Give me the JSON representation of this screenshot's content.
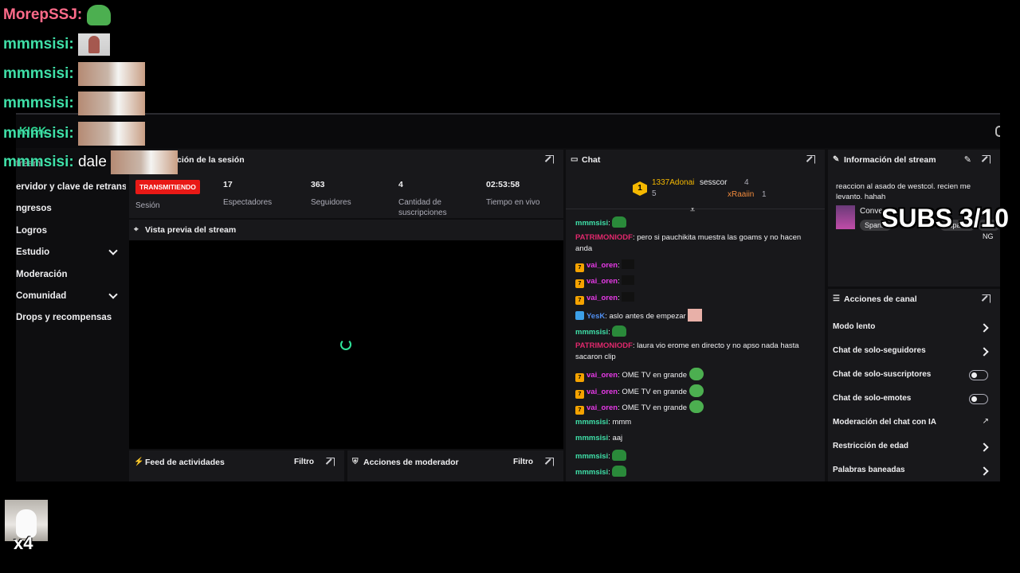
{
  "overlay_chat": [
    {
      "user": "MorepSSJ",
      "colon": ":",
      "text": "",
      "emote": "pepe",
      "color": "#ff6b8a"
    },
    {
      "user": "mmmsisi",
      "colon": ":",
      "text": "",
      "emote": "face",
      "color": "#3fe0a8"
    },
    {
      "user": "mmmsisi",
      "colon": ":",
      "text": "",
      "emote": "cat",
      "color": "#3fe0a8"
    },
    {
      "user": "mmmsisi",
      "colon": ":",
      "text": "",
      "emote": "cat",
      "color": "#3fe0a8"
    },
    {
      "user": "mmmsisi",
      "colon": ":",
      "text": "",
      "emote": "cat",
      "color": "#3fe0a8"
    },
    {
      "user": "mmmsisi",
      "colon": ":",
      "text": "dale",
      "emote": "cat",
      "color": "#3fe0a8"
    }
  ],
  "subs_goal": "SUBS 3/10",
  "cat_alert": {
    "count": "x4"
  },
  "sidebar": {
    "partial_top": "tream",
    "items": [
      {
        "label": "ervidor y clave de retransm",
        "chevron": false
      },
      {
        "label": "ngresos",
        "chevron": false
      },
      {
        "label": "Logros",
        "chevron": false
      },
      {
        "label": "Estudio",
        "chevron": true
      },
      {
        "label": "Moderación",
        "chevron": false
      },
      {
        "label": "Comunidad",
        "chevron": true
      },
      {
        "label": "Drops y recompensas",
        "chevron": false
      }
    ]
  },
  "session": {
    "title": "ción de la sesión",
    "status_badge": "TRANSMITIENDO",
    "status_label": "Sesión",
    "stats": [
      {
        "value": "17",
        "label": "Espectadores"
      },
      {
        "value": "363",
        "label": "Seguidores"
      },
      {
        "value": "4",
        "label": "Cantidad de suscripciones"
      },
      {
        "value": "02:53:58",
        "label": "Tiempo en vivo"
      }
    ]
  },
  "preview": {
    "title": "Vista previa del stream"
  },
  "activity_feed": {
    "title": "Feed de actividades",
    "filter": "Filtro"
  },
  "mod_actions": {
    "title": "Acciones de moderador",
    "filter": "Filtro"
  },
  "chat": {
    "title": "Chat",
    "leaderboard": {
      "rank": "1",
      "first": {
        "name": "1337Adonai",
        "count": "5"
      },
      "second": {
        "name": "sesscor",
        "count": "4"
      },
      "third": {
        "name": "xRaaiin",
        "count": "1"
      }
    },
    "messages": [
      {
        "user": "mmmsisi",
        "color": "#3fe0a8",
        "text": "",
        "emote": "green",
        "badge": ""
      },
      {
        "user": "PATRIMONIODF",
        "color": "#e0286c",
        "text": ": pero si pauchikita muestra las goams y no hacen anda",
        "emote": "",
        "badge": ""
      },
      {
        "user": "vai_oren",
        "color": "#e83ae8",
        "text": ":",
        "emote": "dark",
        "badge": "7"
      },
      {
        "user": "vai_oren",
        "color": "#e83ae8",
        "text": ":",
        "emote": "dark",
        "badge": "7"
      },
      {
        "user": "vai_oren",
        "color": "#e83ae8",
        "text": ":",
        "emote": "dark",
        "badge": "7"
      },
      {
        "user": "YesK",
        "color": "#4f8ef0",
        "text": ": aslo antes de empezar",
        "emote": "pink",
        "badge": "b"
      },
      {
        "user": "mmmsisi",
        "color": "#3fe0a8",
        "text": ":",
        "emote": "green",
        "badge": ""
      },
      {
        "user": "PATRIMONIODF",
        "color": "#e0286c",
        "text": ": laura      vio erome en directo y no apso nada hasta sacaron clip",
        "emote": "",
        "badge": ""
      },
      {
        "user": "vai_oren",
        "color": "#e83ae8",
        "text": ": OME TV en grande",
        "emote": "pepe",
        "badge": "7"
      },
      {
        "user": "vai_oren",
        "color": "#e83ae8",
        "text": ": OME TV en grande",
        "emote": "pepe",
        "badge": "7"
      },
      {
        "user": "vai_oren",
        "color": "#e83ae8",
        "text": ": OME TV en grande",
        "emote": "pepe",
        "badge": "7"
      },
      {
        "user": "mmmsisi",
        "color": "#3fe0a8",
        "text": ": mmm",
        "emote": "",
        "badge": ""
      },
      {
        "user": "mmmsisi",
        "color": "#3fe0a8",
        "text": ": aaj",
        "emote": "",
        "badge": ""
      },
      {
        "user": "mmmsisi",
        "color": "#3fe0a8",
        "text": ":",
        "emote": "green",
        "badge": ""
      },
      {
        "user": "mmmsisi",
        "color": "#3fe0a8",
        "text": ":",
        "emote": "green",
        "badge": ""
      }
    ]
  },
  "stream_info": {
    "title": "Información del stream",
    "description": "reaccion al asado de westcol. recien me levanto. hahah",
    "category": "Conve",
    "tags": [
      "Spanis",
      "Español",
      "E NG"
    ]
  },
  "channel_actions": {
    "title": "Acciones de canal",
    "rows": [
      {
        "label": "Modo lento",
        "control": "chevron"
      },
      {
        "label": "Chat de solo-seguidores",
        "control": "chevron"
      },
      {
        "label": "Chat de solo-suscriptores",
        "control": "toggle"
      },
      {
        "label": "Chat de solo-emotes",
        "control": "toggle"
      },
      {
        "label": "Moderación del chat con IA",
        "control": "external"
      },
      {
        "label": "Restricción de edad",
        "control": "chevron"
      },
      {
        "label": "Palabras baneadas",
        "control": "chevron"
      }
    ]
  },
  "colors": {
    "accent": "#2fe49a",
    "live": "#e91916",
    "panel": "#18181b",
    "bg": "#0e0e10"
  }
}
